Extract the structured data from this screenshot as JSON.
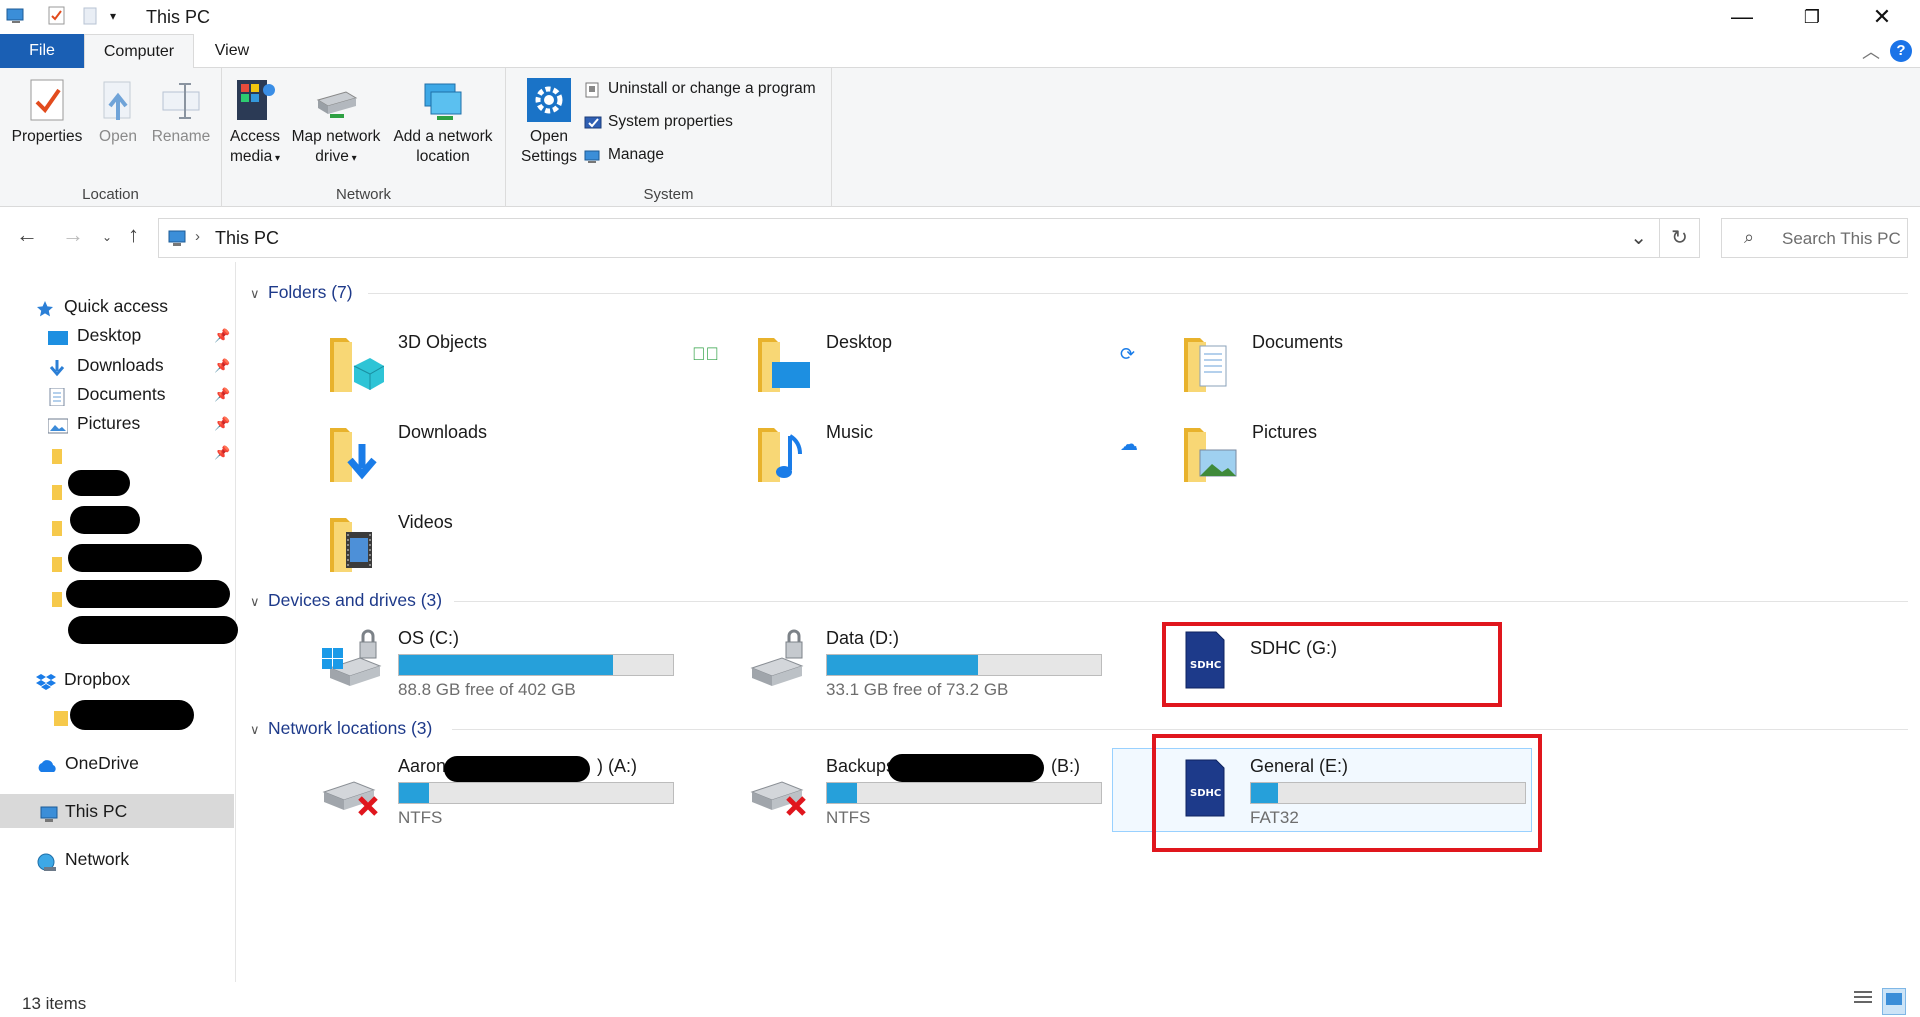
{
  "window": {
    "title": "This PC"
  },
  "ribbon_tabs": {
    "file": "File",
    "computer": "Computer",
    "view": "View"
  },
  "ribbon": {
    "location": {
      "label": "Location",
      "properties": "Properties",
      "open": "Open",
      "rename": "Rename"
    },
    "network": {
      "label": "Network",
      "access_media": "Access media",
      "map_drive": "Map network drive",
      "add_location": "Add a network location"
    },
    "system": {
      "label": "System",
      "open_settings": "Open Settings",
      "uninstall": "Uninstall or change a program",
      "system_properties": "System properties",
      "manage": "Manage"
    }
  },
  "address": {
    "path": "This PC",
    "search_placeholder": "Search This PC"
  },
  "navpane": {
    "quick_access": "Quick access",
    "desktop": "Desktop",
    "downloads": "Downloads",
    "documents": "Documents",
    "pictures": "Pictures",
    "dropbox": "Dropbox",
    "onedrive": "OneDrive",
    "this_pc": "This PC",
    "network": "Network"
  },
  "groups": {
    "folders": "Folders (7)",
    "devices": "Devices and drives (3)",
    "network_locations": "Network locations (3)"
  },
  "folders": [
    "3D Objects",
    "Desktop",
    "Documents",
    "Downloads",
    "Music",
    "Pictures",
    "Videos"
  ],
  "drives": {
    "c": {
      "name": "OS (C:)",
      "free": "88.8 GB free of 402 GB",
      "used_fraction": 0.78
    },
    "d": {
      "name": "Data (D:)",
      "free": "33.1 GB free of 73.2 GB",
      "used_fraction": 0.55
    },
    "g": {
      "name": "SDHC (G:)"
    }
  },
  "network_drives": {
    "a": {
      "name_prefix": "Aaron (",
      "name_suffix": ") (A:)",
      "fs": "NTFS",
      "used_fraction": 0.11
    },
    "b": {
      "name_prefix": "Backups",
      "name_suffix": "(B:)",
      "fs": "NTFS",
      "used_fraction": 0.11
    },
    "e": {
      "name": "General (E:)",
      "fs": "FAT32",
      "used_fraction": 0.1
    }
  },
  "status": {
    "count": "13 items"
  },
  "colors": {
    "accent": "#1a5fb4",
    "drive_bar": "#26a0da",
    "highlight": "#e0161d"
  },
  "icons": [
    "this-pc-icon",
    "properties-icon",
    "open-icon",
    "rename-icon",
    "access-media-icon",
    "map-drive-icon",
    "network-location-icon",
    "settings-gear-icon",
    "folder-icon",
    "drive-icon",
    "sd-card-icon",
    "network-drive-icon"
  ]
}
